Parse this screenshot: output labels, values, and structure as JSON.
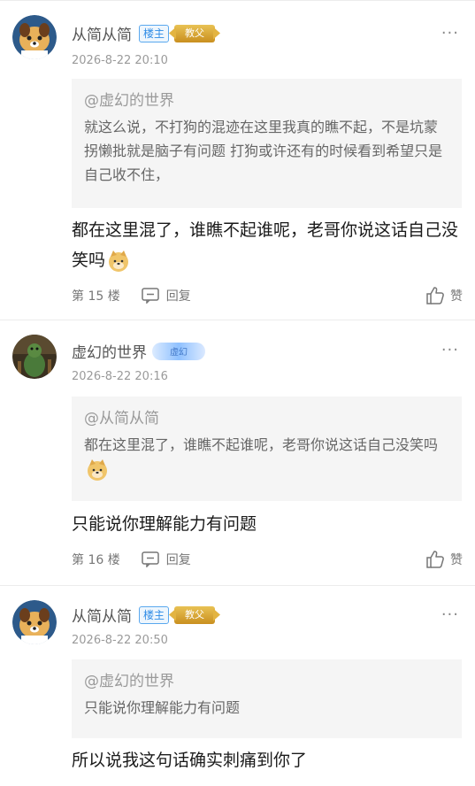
{
  "posts": [
    {
      "username": "从简从简",
      "badge_lz": "楼主",
      "badge_jf": "教父",
      "time": "2026-8-22 20:10",
      "quote_name": "@虚幻的世界",
      "quote_text": "就这么说，不打狗的混迹在这里我真的瞧不起，不是坑蒙拐懒批就是脑子有问题 打狗或许还有的时候看到希望只是自己收不住，",
      "content": "都在这里混了，谁瞧不起谁呢，老哥你说这话自己没笑吗",
      "floor": "第 15 楼",
      "reply": "回复",
      "like": "赞"
    },
    {
      "username": "虚幻的世界",
      "badge_lv": "虚幻",
      "time": "2026-8-22 20:16",
      "quote_name": "@从简从简",
      "quote_text": "都在这里混了，谁瞧不起谁呢，老哥你说这话自己没笑吗",
      "content": "只能说你理解能力有问题",
      "floor": "第 16 楼",
      "reply": "回复",
      "like": "赞"
    },
    {
      "username": "从简从简",
      "badge_lz": "楼主",
      "badge_jf": "教父",
      "time": "2026-8-22 20:50",
      "quote_name": "@虚幻的世界",
      "quote_text": "只能说你理解能力有问题",
      "content": "所以说我这句话确实刺痛到你了"
    }
  ],
  "more_icon": "···"
}
